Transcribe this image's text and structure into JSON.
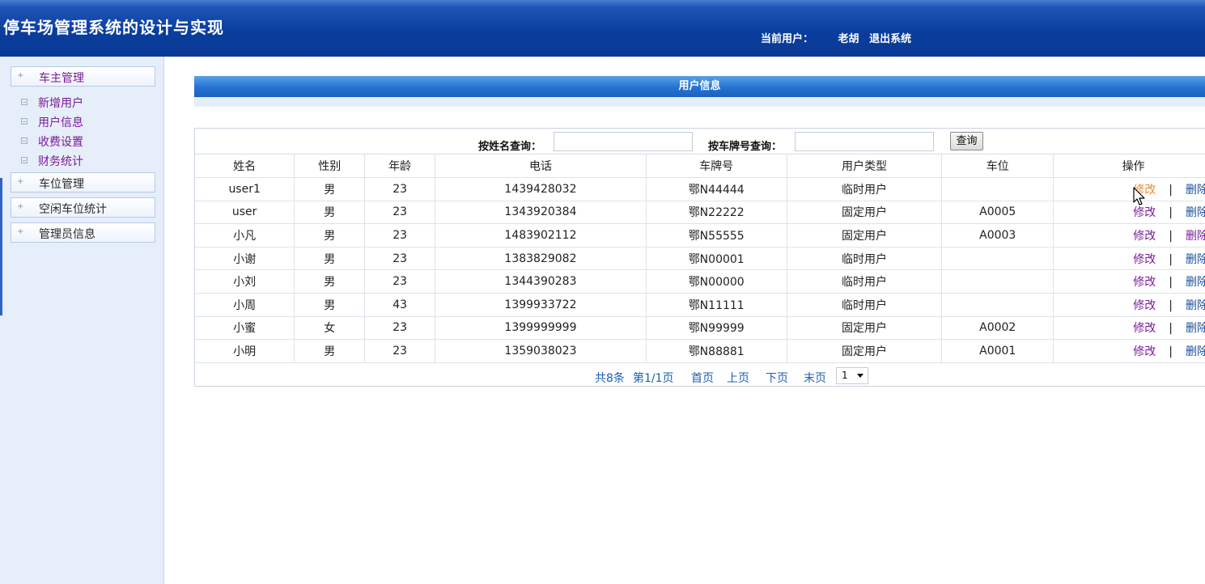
{
  "header": {
    "title": "停车场管理系统的设计与实现",
    "current_user_label": "当前用户：",
    "user_name": "老胡",
    "logout": "退出系统"
  },
  "sidebar": {
    "groups": [
      {
        "label": "车主管理",
        "items": [
          "新增用户",
          "用户信息",
          "收费设置",
          "财务统计"
        ]
      },
      {
        "label": "车位管理"
      },
      {
        "label": "空闲车位统计"
      },
      {
        "label": "管理员信息"
      }
    ]
  },
  "panel": {
    "title": "用户信息"
  },
  "search": {
    "by_name_label": "按姓名查询：",
    "by_name_value": "",
    "by_plate_label": "按车牌号查询：",
    "by_plate_value": "",
    "button": "查询"
  },
  "table": {
    "headers": [
      "姓名",
      "性别",
      "年龄",
      "电话",
      "车牌号",
      "用户类型",
      "车位",
      "操作"
    ],
    "rows": [
      {
        "name": "user1",
        "gender": "男",
        "age": "23",
        "phone": "1439428032",
        "plate": "鄂N44444",
        "type": "临时用户",
        "slot": ""
      },
      {
        "name": "user",
        "gender": "男",
        "age": "23",
        "phone": "1343920384",
        "plate": "鄂N22222",
        "type": "固定用户",
        "slot": "A0005"
      },
      {
        "name": "小凡",
        "gender": "男",
        "age": "23",
        "phone": "1483902112",
        "plate": "鄂N55555",
        "type": "固定用户",
        "slot": "A0003"
      },
      {
        "name": "小谢",
        "gender": "男",
        "age": "23",
        "phone": "1383829082",
        "plate": "鄂N00001",
        "type": "临时用户",
        "slot": ""
      },
      {
        "name": "小刘",
        "gender": "男",
        "age": "23",
        "phone": "1344390283",
        "plate": "鄂N00000",
        "type": "临时用户",
        "slot": ""
      },
      {
        "name": "小周",
        "gender": "男",
        "age": "43",
        "phone": "1399933722",
        "plate": "鄂N11111",
        "type": "临时用户",
        "slot": ""
      },
      {
        "name": "小蜜",
        "gender": "女",
        "age": "23",
        "phone": "1399999999",
        "plate": "鄂N99999",
        "type": "固定用户",
        "slot": "A0002"
      },
      {
        "name": "小明",
        "gender": "男",
        "age": "23",
        "phone": "1359038023",
        "plate": "鄂N88881",
        "type": "固定用户",
        "slot": "A0001"
      }
    ],
    "edit_label": "修改",
    "separator": "|",
    "delete_label": "删除"
  },
  "pager": {
    "total": "共8条",
    "page_info": "第1/1页",
    "first": "首页",
    "prev": "上页",
    "next": "下页",
    "last": "末页",
    "selected_page": "1"
  },
  "colors": {
    "header_blue": "#0a3d9e",
    "panel_blue": "#2472d0",
    "sidebar_bg": "#e6eef9",
    "link_purple": "#7a1a9a",
    "link_blue": "#1c4f9c",
    "hover_orange": "#e98a2a"
  }
}
